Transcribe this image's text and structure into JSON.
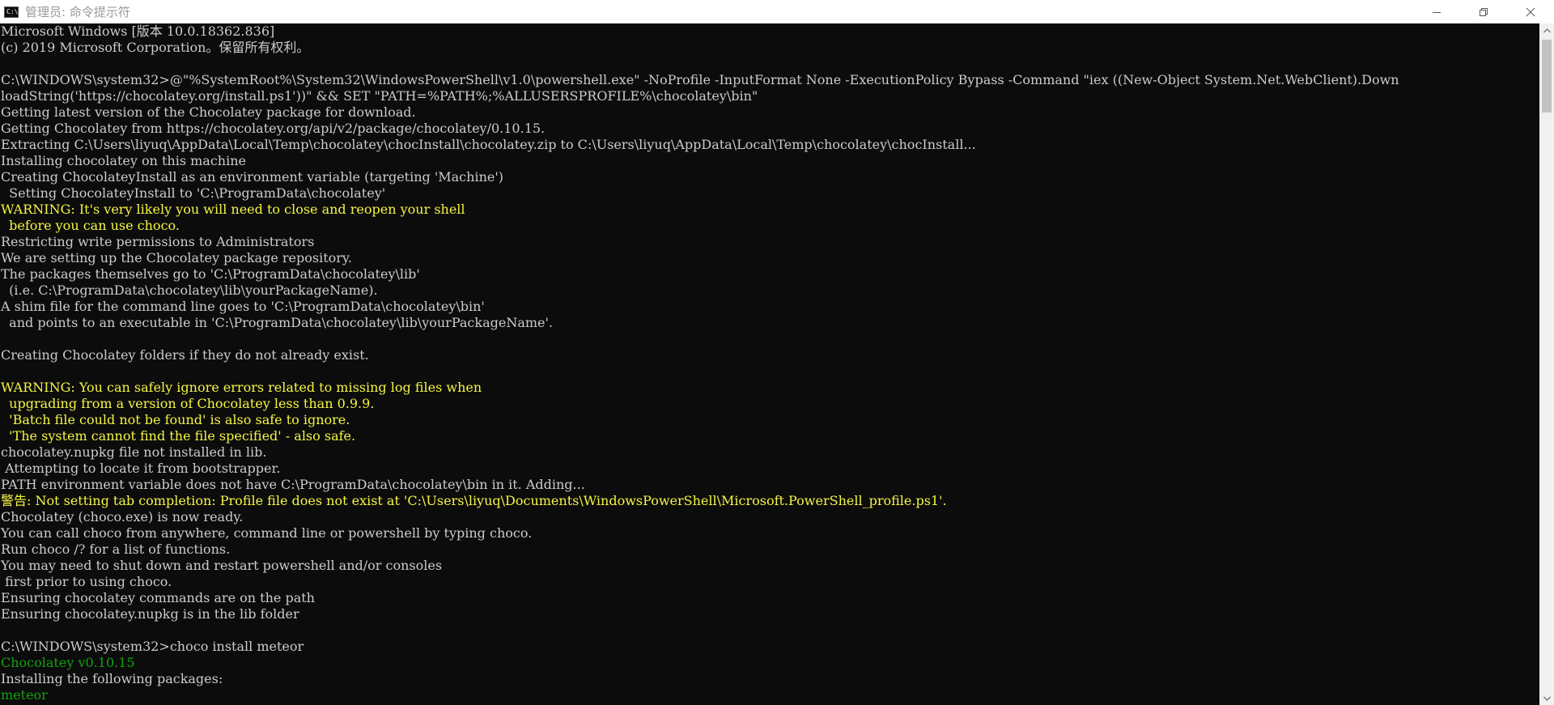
{
  "window": {
    "title": "管理员: 命令提示符",
    "icon_label": "C:\\"
  },
  "controls": [
    "minimize-icon",
    "maximize-icon",
    "close-icon"
  ],
  "colors": {
    "background": "#0c0c0c",
    "text": "#cccccc",
    "warning": "#f5f543",
    "success": "#13a10e"
  },
  "console": {
    "lines": [
      {
        "text": "Microsoft Windows [版本 10.0.18362.836]",
        "type": "normal"
      },
      {
        "text": "(c) 2019 Microsoft Corporation。保留所有权利。",
        "type": "normal"
      },
      {
        "text": "",
        "type": "normal"
      },
      {
        "text": "C:\\WINDOWS\\system32>@\"%SystemRoot%\\System32\\WindowsPowerShell\\v1.0\\powershell.exe\" -NoProfile -InputFormat None -ExecutionPolicy Bypass -Command \"iex ((New-Object System.Net.WebClient).Down",
        "type": "normal"
      },
      {
        "text": "loadString('https://chocolatey.org/install.ps1'))\" && SET \"PATH=%PATH%;%ALLUSERSPROFILE%\\chocolatey\\bin\"",
        "type": "normal"
      },
      {
        "text": "Getting latest version of the Chocolatey package for download.",
        "type": "normal"
      },
      {
        "text": "Getting Chocolatey from https://chocolatey.org/api/v2/package/chocolatey/0.10.15.",
        "type": "normal"
      },
      {
        "text": "Extracting C:\\Users\\liyuq\\AppData\\Local\\Temp\\chocolatey\\chocInstall\\chocolatey.zip to C:\\Users\\liyuq\\AppData\\Local\\Temp\\chocolatey\\chocInstall...",
        "type": "normal"
      },
      {
        "text": "Installing chocolatey on this machine",
        "type": "normal"
      },
      {
        "text": "Creating ChocolateyInstall as an environment variable (targeting 'Machine')",
        "type": "normal"
      },
      {
        "text": "  Setting ChocolateyInstall to 'C:\\ProgramData\\chocolatey'",
        "type": "normal"
      },
      {
        "text": "WARNING: It's very likely you will need to close and reopen your shell",
        "type": "warn"
      },
      {
        "text": "  before you can use choco.",
        "type": "warn"
      },
      {
        "text": "Restricting write permissions to Administrators",
        "type": "normal"
      },
      {
        "text": "We are setting up the Chocolatey package repository.",
        "type": "normal"
      },
      {
        "text": "The packages themselves go to 'C:\\ProgramData\\chocolatey\\lib'",
        "type": "normal"
      },
      {
        "text": "  (i.e. C:\\ProgramData\\chocolatey\\lib\\yourPackageName).",
        "type": "normal"
      },
      {
        "text": "A shim file for the command line goes to 'C:\\ProgramData\\chocolatey\\bin'",
        "type": "normal"
      },
      {
        "text": "  and points to an executable in 'C:\\ProgramData\\chocolatey\\lib\\yourPackageName'.",
        "type": "normal"
      },
      {
        "text": "",
        "type": "normal"
      },
      {
        "text": "Creating Chocolatey folders if they do not already exist.",
        "type": "normal"
      },
      {
        "text": "",
        "type": "normal"
      },
      {
        "text": "WARNING: You can safely ignore errors related to missing log files when",
        "type": "warn"
      },
      {
        "text": "  upgrading from a version of Chocolatey less than 0.9.9.",
        "type": "warn"
      },
      {
        "text": "  'Batch file could not be found' is also safe to ignore.",
        "type": "warn"
      },
      {
        "text": "  'The system cannot find the file specified' - also safe.",
        "type": "warn"
      },
      {
        "text": "chocolatey.nupkg file not installed in lib.",
        "type": "normal"
      },
      {
        "text": " Attempting to locate it from bootstrapper.",
        "type": "normal"
      },
      {
        "text": "PATH environment variable does not have C:\\ProgramData\\chocolatey\\bin in it. Adding...",
        "type": "normal"
      },
      {
        "text": "警告: Not setting tab completion: Profile file does not exist at 'C:\\Users\\liyuq\\Documents\\WindowsPowerShell\\Microsoft.PowerShell_profile.ps1'.",
        "type": "warn"
      },
      {
        "text": "Chocolatey (choco.exe) is now ready.",
        "type": "normal"
      },
      {
        "text": "You can call choco from anywhere, command line or powershell by typing choco.",
        "type": "normal"
      },
      {
        "text": "Run choco /? for a list of functions.",
        "type": "normal"
      },
      {
        "text": "You may need to shut down and restart powershell and/or consoles",
        "type": "normal"
      },
      {
        "text": " first prior to using choco.",
        "type": "normal"
      },
      {
        "text": "Ensuring chocolatey commands are on the path",
        "type": "normal"
      },
      {
        "text": "Ensuring chocolatey.nupkg is in the lib folder",
        "type": "normal"
      },
      {
        "text": "",
        "type": "normal"
      },
      {
        "text": "C:\\WINDOWS\\system32>choco install meteor",
        "type": "normal"
      },
      {
        "text": "Chocolatey v0.10.15",
        "type": "good"
      },
      {
        "text": "Installing the following packages:",
        "type": "normal"
      },
      {
        "text": "meteor",
        "type": "good"
      }
    ]
  }
}
